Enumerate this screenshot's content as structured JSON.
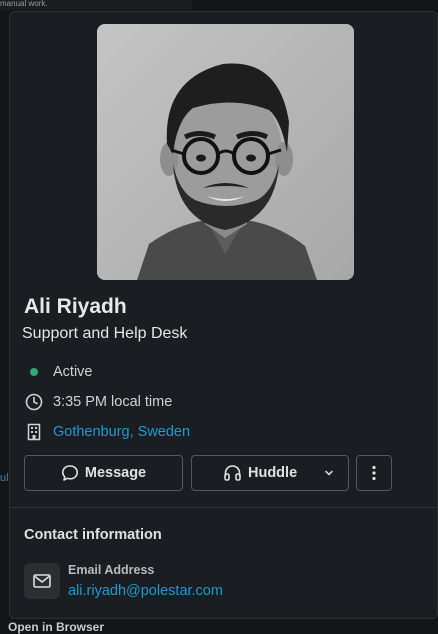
{
  "background": {
    "top_text": "manual work.",
    "bottom_text": "Open in Browser",
    "left_text": "ul"
  },
  "profile": {
    "name": "Ali Riyadh",
    "title": "Support and Help Desk",
    "status": "Active",
    "local_time": "3:35 PM local time",
    "location": "Gothenburg, Sweden"
  },
  "actions": {
    "message_label": "Message",
    "huddle_label": "Huddle"
  },
  "contact": {
    "section_title": "Contact information",
    "email_label": "Email Address",
    "email_value": "ali.riyadh@polestar.com"
  },
  "colors": {
    "status_active": "#2bac76",
    "link": "#1d9bd1",
    "card_bg": "#1a1d21"
  },
  "icons": {
    "status": "active-dot-icon",
    "time": "clock-icon",
    "location": "building-icon",
    "message": "chat-bubble-icon",
    "huddle": "headphones-icon",
    "huddle_menu": "chevron-down-icon",
    "more": "more-vertical-icon",
    "email": "envelope-icon"
  }
}
